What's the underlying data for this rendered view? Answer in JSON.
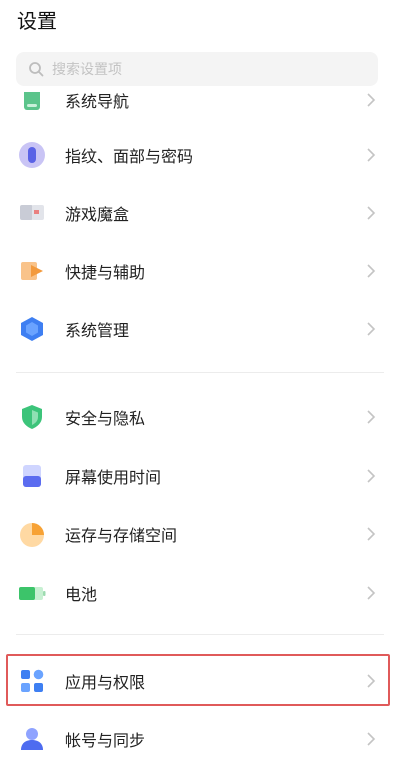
{
  "header": {
    "title": "设置"
  },
  "search": {
    "placeholder": "搜索设置项"
  },
  "items": [
    {
      "label": "系统导航",
      "icon": "navigation-icon"
    },
    {
      "label": "指纹、面部与密码",
      "icon": "fingerprint-icon"
    },
    {
      "label": "游戏魔盒",
      "icon": "game-box-icon"
    },
    {
      "label": "快捷与辅助",
      "icon": "shortcut-icon"
    },
    {
      "label": "系统管理",
      "icon": "system-management-icon"
    },
    {
      "label": "安全与隐私",
      "icon": "shield-icon"
    },
    {
      "label": "屏幕使用时间",
      "icon": "hourglass-icon"
    },
    {
      "label": "运存与存储空间",
      "icon": "storage-pie-icon"
    },
    {
      "label": "电池",
      "icon": "battery-icon"
    },
    {
      "label": "应用与权限",
      "icon": "apps-icon",
      "highlighted": true
    },
    {
      "label": "帐号与同步",
      "icon": "account-icon"
    }
  ],
  "colors": {
    "highlight": "#e05a5a",
    "accent": "#4e7cf6"
  }
}
